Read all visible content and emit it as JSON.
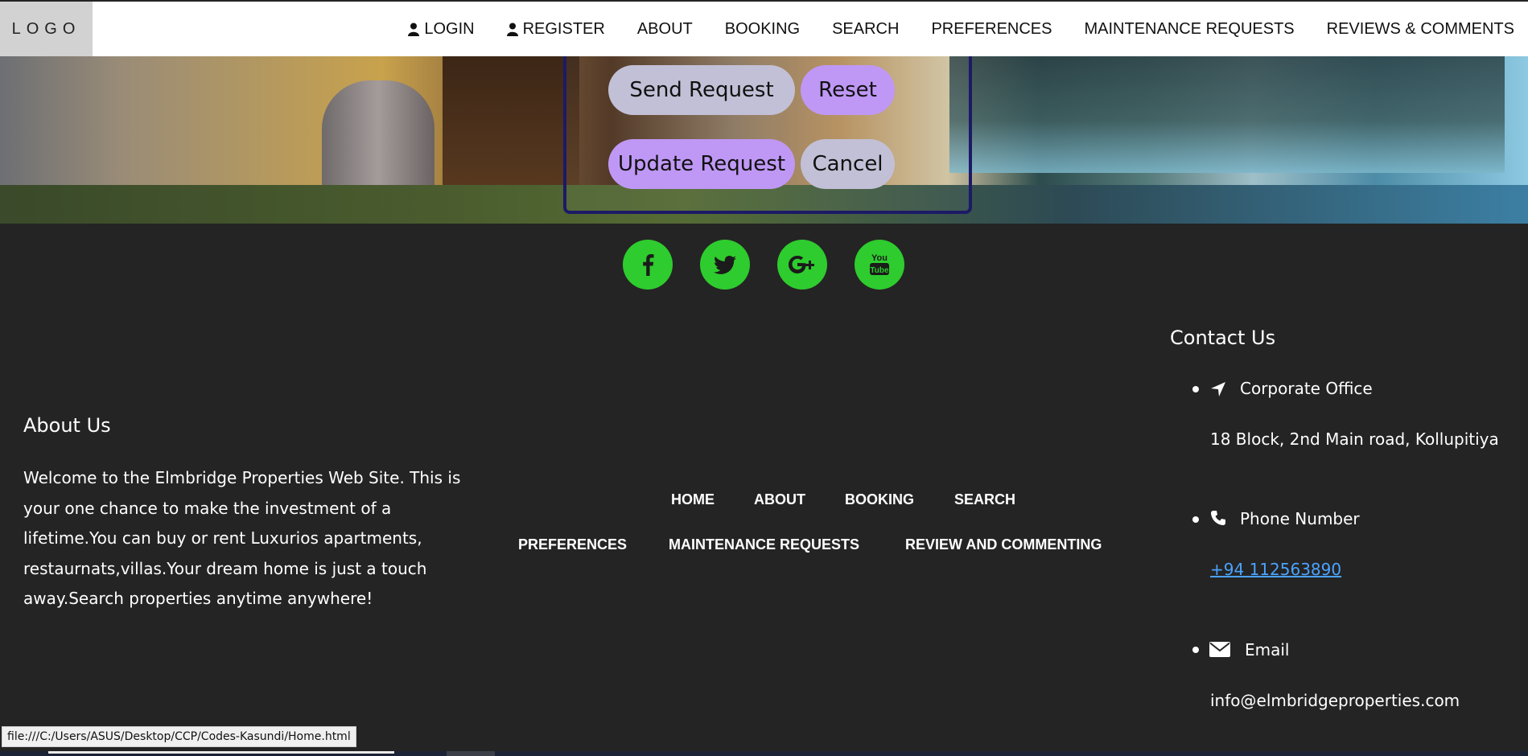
{
  "header": {
    "logo": "LOGO",
    "nav": {
      "login": "LOGIN",
      "register": "REGISTER",
      "about": "ABOUT",
      "booking": "BOOKING",
      "search": "SEARCH",
      "preferences": "PREFERENCES",
      "maintenance": "MAINTENANCE REQUESTS",
      "reviews": "REVIEWS & COMMENTS"
    }
  },
  "form": {
    "send_label": "Send Request",
    "reset_label": "Reset",
    "update_label": "Update Request",
    "cancel_label": "Cancel"
  },
  "social": {
    "icons": [
      "facebook-icon",
      "twitter-icon",
      "google-plus-icon",
      "youtube-icon"
    ],
    "youtube_text_top": "You",
    "youtube_text_bottom": "Tube"
  },
  "footer": {
    "about_title": "About Us",
    "about_text": "Welcome to the Elmbridge Properties Web Site. This is your one chance to make the investment of a lifetime.You can buy or rent Luxurios apartments, restaurnats,villas.Your dream home is just a touch away.Search properties anytime anywhere!",
    "links": {
      "home": "HOME",
      "about": "ABOUT",
      "booking": "BOOKING",
      "search": "SEARCH",
      "preferences": "PREFERENCES",
      "maintenance": "MAINTENANCE REQUESTS",
      "review": "REVIEW AND COMMENTING"
    },
    "contact": {
      "title": "Contact Us",
      "office_label": "Corporate Office",
      "office_value": "18 Block, 2nd Main road, Kollupitiya",
      "phone_label": "Phone Number",
      "phone_value": "+94 112563890",
      "email_label": "Email",
      "email_value": "info@elmbridgeproperties.com"
    }
  },
  "status_bar": {
    "url": "file:///C:/Users/ASUS/Desktop/CCP/Codes-Kasundi/Home.html"
  },
  "colors": {
    "footer_bg": "#242424",
    "social_green": "#2ecc2e",
    "pill_grey": "#c2c0d6",
    "pill_purple": "#bf98f5",
    "link_blue": "#4aa3ff",
    "panel_border": "#1c1a66"
  }
}
